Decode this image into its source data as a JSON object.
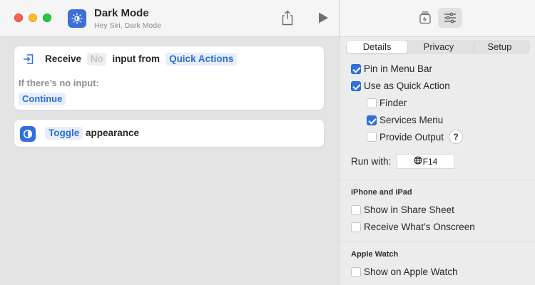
{
  "window": {
    "title": "Dark Mode",
    "subtitle": "Hey Siri, Dark Mode"
  },
  "actions": {
    "receive": {
      "verb": "Receive",
      "type_token": "No",
      "middle": "input from",
      "source_token": "Quick Actions",
      "no_input_label": "If there’s no input:",
      "no_input_action": "Continue"
    },
    "toggle": {
      "token": "Toggle",
      "rest": "appearance"
    }
  },
  "inspector": {
    "tabs": [
      {
        "label": "Details",
        "active": true
      },
      {
        "label": "Privacy",
        "active": false
      },
      {
        "label": "Setup",
        "active": false
      }
    ],
    "options": {
      "pin_menu_bar": {
        "label": "Pin in Menu Bar",
        "checked": true
      },
      "quick_action": {
        "label": "Use as Quick Action",
        "checked": true
      },
      "finder": {
        "label": "Finder",
        "checked": false
      },
      "services_menu": {
        "label": "Services Menu",
        "checked": true
      },
      "provide_output": {
        "label": "Provide Output",
        "checked": false
      },
      "help_glyph": "?"
    },
    "run_with": {
      "label": "Run with:",
      "shortcut": "F14"
    },
    "iphone_ipad": {
      "heading": "iPhone and iPad",
      "share_sheet": {
        "label": "Show in Share Sheet",
        "checked": false
      },
      "onscreen": {
        "label": "Receive What’s Onscreen",
        "checked": false
      }
    },
    "apple_watch": {
      "heading": "Apple Watch",
      "show_on_watch": {
        "label": "Show on Apple Watch",
        "checked": false
      }
    }
  },
  "colors": {
    "accent": "#2f6fe0",
    "token_text": "#2a6fd6",
    "close": "#fe5f57",
    "minimize": "#febc2e",
    "maximize": "#28c840"
  },
  "icons": [
    "app-brightness-icon",
    "share-icon",
    "run-icon",
    "receive-input-icon",
    "appearance-toggle-icon",
    "library-icon",
    "details-sliders-icon",
    "globe-icon"
  ]
}
